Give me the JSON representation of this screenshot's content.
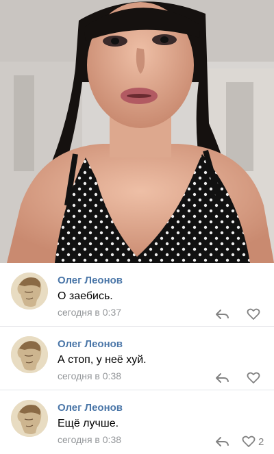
{
  "comments": [
    {
      "author": "Олег Леонов",
      "text": "О заебись.",
      "time": "сегодня в 0:37",
      "likes": ""
    },
    {
      "author": "Олег Леонов",
      "text": "А стоп, у неё хуй.",
      "time": "сегодня в 0:38",
      "likes": ""
    },
    {
      "author": "Олег Леонов",
      "text": "Ещё лучше.",
      "time": "сегодня в 0:38",
      "likes": "2"
    }
  ],
  "icons": {
    "reply": "reply-arrow-icon",
    "like": "heart-outline-icon"
  },
  "colors": {
    "author": "#4a76a8",
    "meta": "#939699",
    "icon": "#828282"
  }
}
